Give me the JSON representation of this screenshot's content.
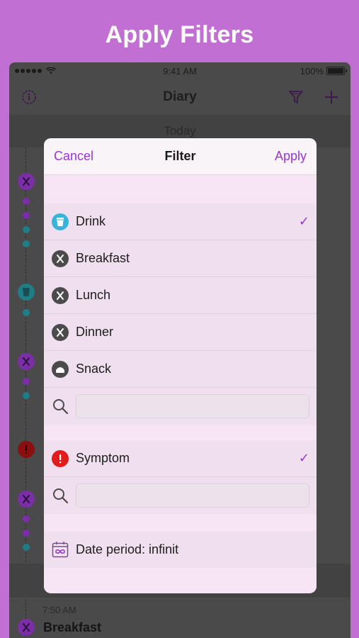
{
  "banner": {
    "title": "Apply Filters"
  },
  "status_bar": {
    "time": "9:41 AM",
    "battery": "100%"
  },
  "nav": {
    "title": "Diary",
    "left_icon": "info-gear-icon",
    "filter_icon": "filter-icon",
    "add_icon": "plus-icon"
  },
  "day_header": {
    "label": "Today"
  },
  "entry": {
    "time": "7:50 AM",
    "label": "Breakfast"
  },
  "filter": {
    "cancel": "Cancel",
    "title": "Filter",
    "apply": "Apply",
    "food_items": [
      {
        "label": "Drink",
        "icon": "cup-icon",
        "checked": true
      },
      {
        "label": "Breakfast",
        "icon": "fork-knife-icon",
        "checked": false
      },
      {
        "label": "Lunch",
        "icon": "fork-knife-icon",
        "checked": false
      },
      {
        "label": "Dinner",
        "icon": "fork-knife-icon",
        "checked": false
      },
      {
        "label": "Snack",
        "icon": "snack-icon",
        "checked": false
      }
    ],
    "symptom_items": [
      {
        "label": "Symptom",
        "icon": "exclamation-icon",
        "checked": true
      }
    ],
    "date_period": {
      "label": "Date period: infinit",
      "icon": "calendar-infinity-icon"
    },
    "check_mark": "✓"
  },
  "colors": {
    "accent": "#9a36d1",
    "drink_icon": "#39b3dc",
    "food_icon": "#4b4b4b",
    "symptom_icon": "#e21b1b",
    "timeline_purple": "#7b2ea8",
    "timeline_teal": "#1f7d86"
  }
}
